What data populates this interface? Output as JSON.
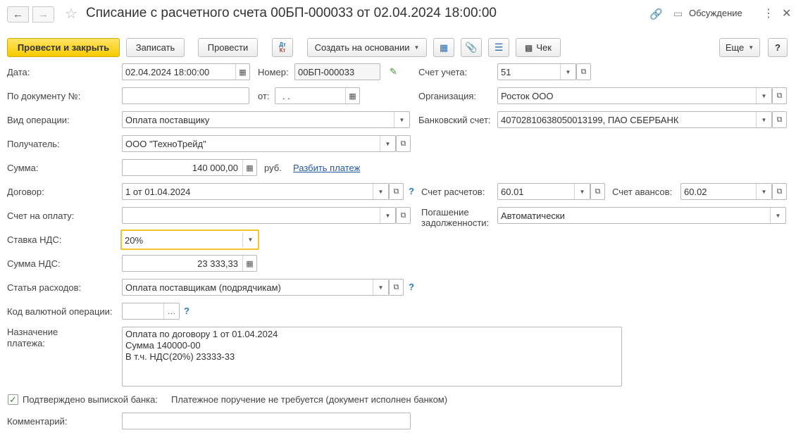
{
  "window": {
    "title": "Списание с расчетного счета 00БП-000033 от 02.04.2024 18:00:00",
    "discussion_label": "Обсуждение"
  },
  "toolbar": {
    "post_close": "Провести и закрыть",
    "save": "Записать",
    "post": "Провести",
    "dt_kt": "Дт Кт",
    "create_based_on": "Создать на основании",
    "receipt": "Чек",
    "more": "Еще",
    "help": "?"
  },
  "form": {
    "date": {
      "label": "Дата:",
      "value": "02.04.2024 18:00:00"
    },
    "number": {
      "label": "Номер:",
      "value": "00БП-000033"
    },
    "account": {
      "label": "Счет учета:",
      "value": "51"
    },
    "by_document": {
      "label": "По документу №:",
      "value": "",
      "from_label": "от:",
      "from_value": "  .  ."
    },
    "organization": {
      "label": "Организация:",
      "value": "Росток ООО"
    },
    "operation_type": {
      "label": "Вид операции:",
      "value": "Оплата поставщику"
    },
    "bank_account": {
      "label": "Банковский счет:",
      "value": "40702810638050013199, ПАО СБЕРБАНК"
    },
    "recipient": {
      "label": "Получатель:",
      "value": "ООО \"ТехноТрейд\""
    },
    "amount": {
      "label": "Сумма:",
      "value": "140 000,00",
      "currency": "руб.",
      "split_link": "Разбить платеж"
    },
    "contract": {
      "label": "Договор:",
      "value": "1 от 01.04.2024"
    },
    "settlement_account": {
      "label": "Счет расчетов:",
      "value": "60.01"
    },
    "advance_account": {
      "label": "Счет авансов:",
      "value": "60.02"
    },
    "invoice": {
      "label": "Счет на оплату:",
      "value": ""
    },
    "debt_repayment": {
      "label_line1": "Погашение",
      "label_line2": "задолженности:",
      "value": "Автоматически"
    },
    "vat_rate": {
      "label": "Ставка НДС:",
      "value": "20%"
    },
    "vat_amount": {
      "label": "Сумма НДС:",
      "value": "23 333,33"
    },
    "expense_item": {
      "label": "Статья расходов:",
      "value": "Оплата поставщикам (подрядчикам)"
    },
    "currency_op_code": {
      "label": "Код валютной операции:",
      "value": ""
    },
    "payment_purpose": {
      "label_line1": "Назначение",
      "label_line2": "платежа:",
      "lines": [
        "Оплата по договору 1 от 01.04.2024",
        "Сумма 140000-00",
        "В т.ч. НДС(20%) 23333-33"
      ]
    },
    "bank_confirmed": {
      "label": "Подтверждено выпиской банка:",
      "checked": true,
      "note": "Платежное поручение не требуется (документ исполнен банком)"
    },
    "comment": {
      "label": "Комментарий:",
      "value": ""
    }
  },
  "help_mark": "?"
}
